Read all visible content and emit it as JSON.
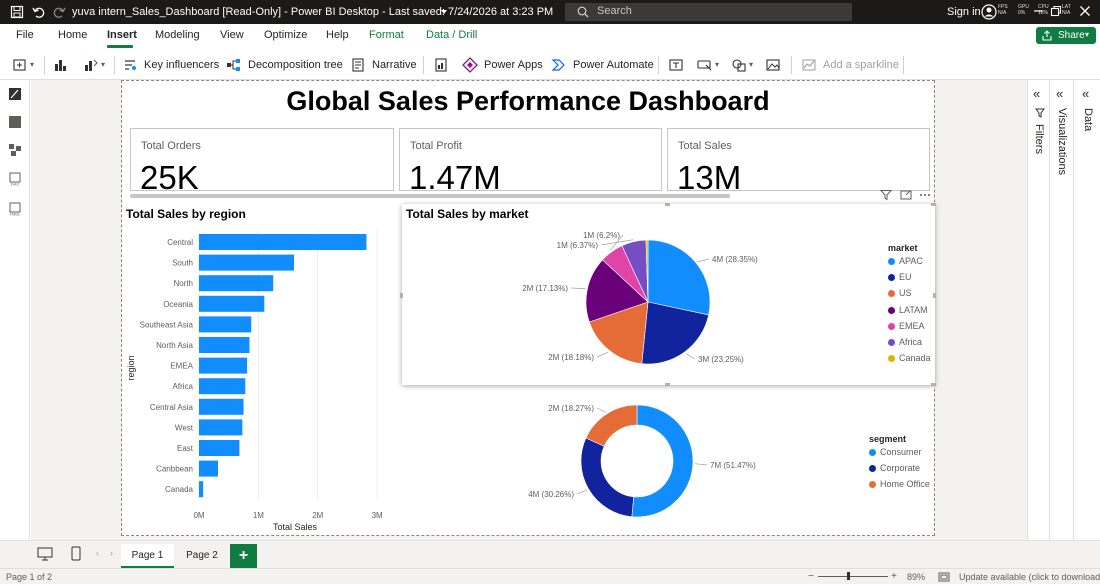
{
  "window": {
    "title": "yuva intern_Sales_Dashboard [Read-Only] - Power BI Desktop - Last saved: 7/24/2026 at 3:23 PM",
    "search_placeholder": "Search",
    "signin": "Sign in",
    "status_indicators": [
      {
        "label": "FPS",
        "value": "N/A"
      },
      {
        "label": "GPU",
        "value": "0%"
      },
      {
        "label": "CPU",
        "value": "18%"
      },
      {
        "label": "LAT",
        "value": "N/A"
      }
    ]
  },
  "menu": {
    "tabs": [
      "File",
      "Home",
      "Insert",
      "Modeling",
      "View",
      "Optimize",
      "Help",
      "Format",
      "Data / Drill"
    ],
    "active": "Insert",
    "share_label": "Share"
  },
  "ribbon": {
    "key_influencers": "Key influencers",
    "decomposition_tree": "Decomposition tree",
    "narrative": "Narrative",
    "power_apps": "Power Apps",
    "power_automate": "Power Automate",
    "add_sparkline": "Add a sparkline"
  },
  "report": {
    "title": "Global Sales Performance Dashboard",
    "kpis": [
      {
        "label": "Total Orders",
        "value": "25K"
      },
      {
        "label": "Total Profit",
        "value": "1.47M"
      },
      {
        "label": "Total Sales",
        "value": "13M"
      }
    ]
  },
  "bar_chart": {
    "title": "Total Sales by region",
    "xlabel": "Total Sales",
    "ylabel": "region",
    "x_ticks": [
      "0M",
      "1M",
      "2M",
      "3M"
    ],
    "color": "#118dff"
  },
  "pie_chart": {
    "title": "Total Sales by market",
    "legend_title": "market",
    "slice_labels": [
      "4M (28.35%)",
      "3M (23.25%)",
      "2M (18.18%)",
      "2M (17.13%)",
      "1M (6.37%)",
      "1M (6.2%)"
    ]
  },
  "donut_chart": {
    "legend_title": "segment",
    "slice_labels": [
      "7M (51.47%)",
      "4M (30.26%)",
      "2M (18.27%)"
    ]
  },
  "chart_data": [
    {
      "type": "bar",
      "orientation": "horizontal",
      "title": "Total Sales by region",
      "xlabel": "Total Sales",
      "ylabel": "region",
      "categories": [
        "Central",
        "South",
        "North",
        "Oceania",
        "Southeast Asia",
        "North Asia",
        "EMEA",
        "Africa",
        "Central Asia",
        "West",
        "East",
        "Caribbean",
        "Canada"
      ],
      "values": [
        2.82,
        1.6,
        1.25,
        1.1,
        0.88,
        0.85,
        0.81,
        0.78,
        0.75,
        0.73,
        0.68,
        0.32,
        0.07
      ],
      "xlim": [
        0,
        3.2
      ],
      "x_ticks": [
        "0M",
        "1M",
        "2M",
        "3M"
      ],
      "color": "#118dff"
    },
    {
      "type": "pie",
      "title": "Total Sales by market",
      "legend_title": "market",
      "categories": [
        "APAC",
        "EU",
        "US",
        "LATAM",
        "EMEA",
        "Africa",
        "Canada"
      ],
      "values": [
        28.35,
        23.25,
        18.18,
        17.13,
        6.2,
        6.37,
        0.52
      ],
      "colors": [
        "#118dff",
        "#12239e",
        "#e66c37",
        "#6b007b",
        "#e044a7",
        "#744ec2",
        "#d9b300"
      ],
      "labels": [
        "4M (28.35%)",
        "3M (23.25%)",
        "2M (18.18%)",
        "2M (17.13%)",
        "1M (6.2%)",
        "1M (6.37%)",
        ""
      ],
      "legend_position": "right"
    },
    {
      "type": "pie",
      "subtype": "donut",
      "legend_title": "segment",
      "categories": [
        "Consumer",
        "Corporate",
        "Home Office"
      ],
      "values": [
        51.47,
        30.26,
        18.27
      ],
      "colors": [
        "#118dff",
        "#12239e",
        "#e66c37"
      ],
      "labels": [
        "7M (51.47%)",
        "4M (30.26%)",
        "2M (18.27%)"
      ],
      "legend_position": "right"
    }
  ],
  "panes": {
    "filters": "Filters",
    "visualizations": "Visualizations",
    "data": "Data"
  },
  "pages": {
    "tabs": [
      "Page 1",
      "Page 2"
    ],
    "active": "Page 1",
    "add": "+"
  },
  "status": {
    "page_count": "Page 1 of 2",
    "zoom": "89%",
    "update": "Update available (click to download)"
  }
}
